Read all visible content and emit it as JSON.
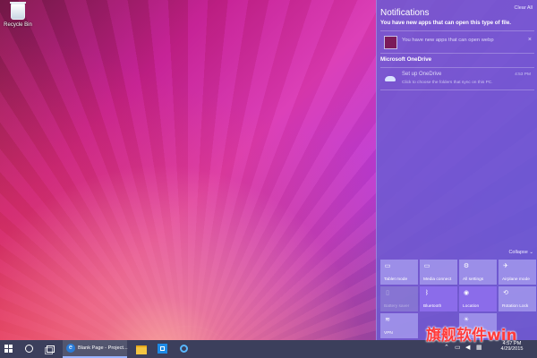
{
  "desktop": {
    "recycle_bin_label": "Recycle Bin"
  },
  "action_center": {
    "title": "Notifications",
    "clear_all": "Clear All",
    "groups": [
      {
        "title": "You have new apps that can open this type of file.",
        "notification": {
          "text": "You have new apps that can open webp",
          "close": "×"
        }
      },
      {
        "title": "Microsoft OneDrive",
        "notification": {
          "title": "Set up OneDrive",
          "text": "Click to choose the folders that sync on this PC.",
          "time": "4:53 PM"
        }
      }
    ],
    "collapse_label": "Collapse ⌄",
    "quick_actions": [
      {
        "label": "Tablet mode",
        "icon": "tablet-icon",
        "state": "off"
      },
      {
        "label": "Media connect",
        "icon": "connect-icon",
        "state": "off"
      },
      {
        "label": "All settings",
        "icon": "gear-icon",
        "state": "off"
      },
      {
        "label": "Airplane mode",
        "icon": "airplane-icon",
        "state": "off"
      },
      {
        "label": "Battery saver",
        "icon": "battery-icon",
        "state": "disabled"
      },
      {
        "label": "Bluetooth",
        "icon": "bluetooth-icon",
        "state": "on"
      },
      {
        "label": "Location",
        "icon": "location-icon",
        "state": "on"
      },
      {
        "label": "Rotation Lock",
        "icon": "rotation-icon",
        "state": "off"
      },
      {
        "label": "VPN",
        "icon": "vpn-icon",
        "state": "off"
      },
      {
        "label": "",
        "icon": "brightness-icon",
        "state": "off"
      }
    ]
  },
  "taskbar": {
    "active_app_label": "Blank Page - Project...",
    "clock": {
      "time": "4:57 PM",
      "date": "4/29/2015"
    }
  },
  "watermark": "旗舰软件win"
}
